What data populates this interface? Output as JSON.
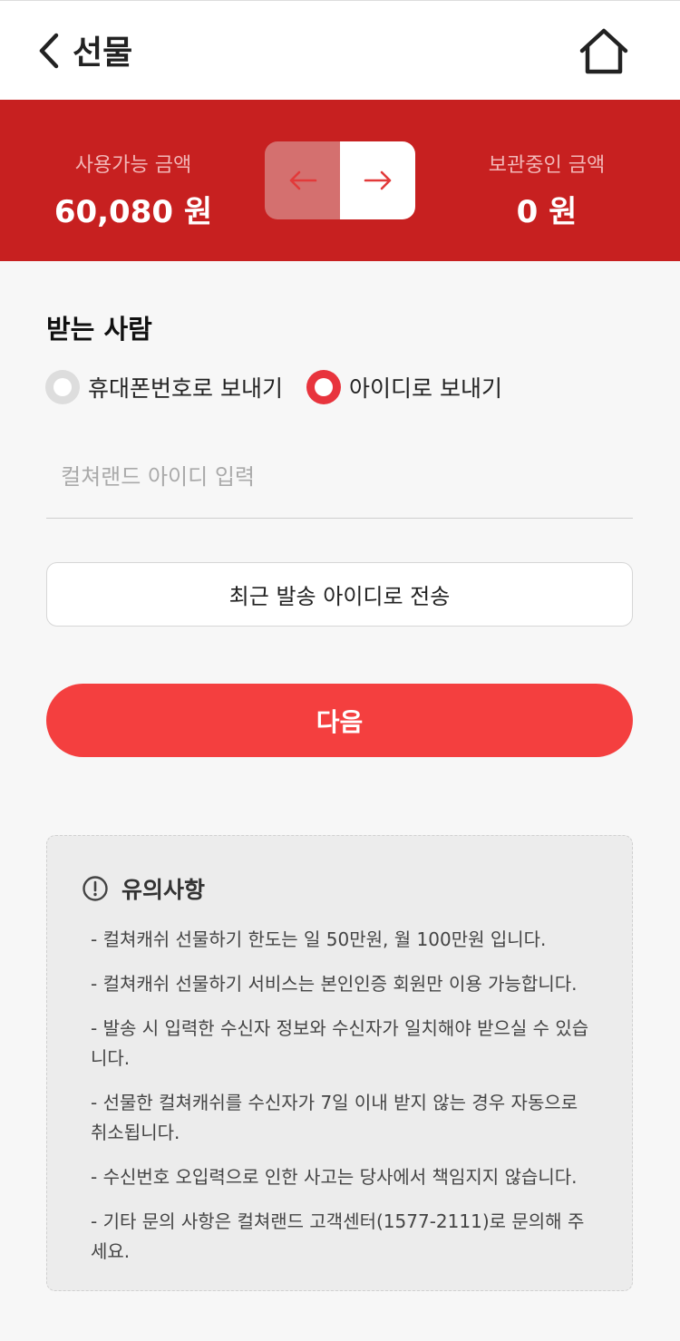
{
  "header": {
    "title": "선물"
  },
  "balance": {
    "available_label": "사용가능 금액",
    "available_amount": "60,080 원",
    "stored_label": "보관중인 금액",
    "stored_amount": "0 원"
  },
  "recipient": {
    "title": "받는 사람",
    "options": [
      {
        "label": "휴대폰번호로 보내기",
        "selected": false
      },
      {
        "label": "아이디로 보내기",
        "selected": true
      }
    ],
    "input_placeholder": "컬쳐랜드 아이디 입력",
    "input_value": ""
  },
  "buttons": {
    "recent": "최근 발송 아이디로 전송",
    "next": "다음"
  },
  "notice": {
    "title": "유의사항",
    "items": [
      "- 컬쳐캐쉬 선물하기 한도는 일 50만원, 월 100만원 입니다.",
      "- 컬쳐캐쉬 선물하기 서비스는 본인인증 회원만 이용 가능합니다.",
      "- 발송 시 입력한 수신자 정보와 수신자가 일치해야 받으실 수 있습니다.",
      "- 선물한 컬쳐캐쉬를 수신자가 7일 이내 받지 않는 경우 자동으로 취소됩니다.",
      "- 수신번호 오입력으로 인한 사고는 당사에서 책임지지 않습니다.",
      "- 기타 문의 사항은 컬쳐랜드 고객센터(1577-2111)로 문의해 주세요."
    ]
  },
  "colors": {
    "brand_red": "#c72020",
    "accent_red": "#f43f3f",
    "radio_active": "#e8343d"
  },
  "icons": {
    "back": "chevron-left-icon",
    "home": "home-icon",
    "left": "arrow-left-icon",
    "right": "arrow-right-icon",
    "notice": "exclamation-circle-icon"
  }
}
